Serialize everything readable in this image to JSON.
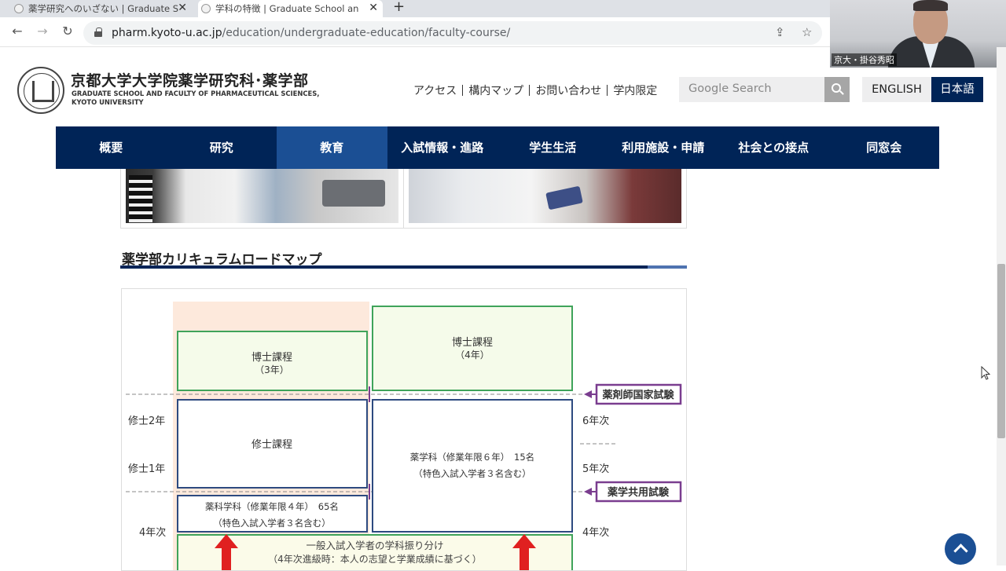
{
  "browser": {
    "tabs": [
      {
        "title": "薬学研究へのいざない | Graduate S",
        "active": false
      },
      {
        "title": "学科の特徴 | Graduate School an",
        "active": true
      }
    ],
    "new_tab": "+",
    "url_domain": "pharm.kyoto-u.ac.jp",
    "url_path": "/education/undergraduate-education/faculty-course/"
  },
  "video_overlay": {
    "name": "京大・掛谷秀昭"
  },
  "site": {
    "logo_jp": "京都大学大学院薬学研究科･薬学部",
    "logo_en_line1": "GRADUATE SCHOOL AND FACULTY OF PHARMACEUTICAL SCIENCES,",
    "logo_en_line2": "KYOTO UNIVERSITY",
    "util_links": [
      "アクセス",
      "構内マップ",
      "お問い合わせ",
      "学内限定"
    ],
    "search_placeholder": "Google Search",
    "lang_en": "ENGLISH",
    "lang_jp": "日本語",
    "nav": [
      "概要",
      "研究",
      "教育",
      "入試情報・進路",
      "学生生活",
      "利用施設・申請",
      "社会との接点",
      "同窓会"
    ],
    "active_nav": "教育"
  },
  "content": {
    "section_title": "薬学部カリキュラムロードマップ"
  },
  "diagram": {
    "doctor3": [
      "博士課程",
      "（3年）"
    ],
    "doctor4": [
      "博士課程",
      "（4年）"
    ],
    "master": "修士課程",
    "pharm_sci": [
      "薬科学科（修業年限４年）　65名",
      "（特色入試入学者３名含む）"
    ],
    "pharm": [
      "薬学科（修業年限６年）　15名",
      "（特色入試入学者３名含む）"
    ],
    "exam_national": "薬剤師国家試験",
    "exam_common": "薬学共用試験",
    "left_labels": [
      "修士2年",
      "修士1年",
      "4年次"
    ],
    "right_labels": [
      "6年次",
      "5年次",
      "4年次"
    ],
    "assignment": [
      "一般入試入学者の学科振り分け",
      "（4年次進級時：本人の志望と学業成績に基づく）"
    ],
    "colors": {
      "green_border": "#3fa35a",
      "navy_border": "#2d4a80",
      "purple": "#7a3d8f",
      "red": "#e02020",
      "peach": "#fde9dc",
      "cream": "#fbfbe9"
    }
  }
}
